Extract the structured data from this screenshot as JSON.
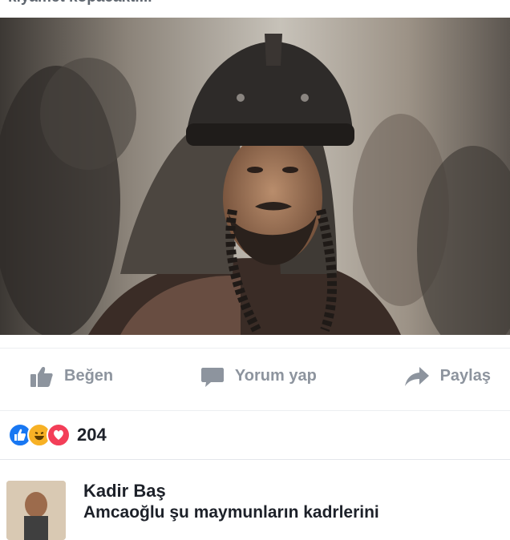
{
  "post": {
    "text": "kıyamet kopacaktı..."
  },
  "actions": {
    "like_label": "Beğen",
    "comment_label": "Yorum yap",
    "share_label": "Paylaş"
  },
  "reactions": {
    "count": "204",
    "icons": [
      "like-icon",
      "haha-icon",
      "love-icon"
    ],
    "colors": {
      "like": "#1877f2",
      "haha": "#f7b125",
      "love": "#f33e58"
    }
  },
  "comment": {
    "author": "Kadir Baş",
    "text": "Amcaoğlu şu maymunların kadrlerini"
  }
}
